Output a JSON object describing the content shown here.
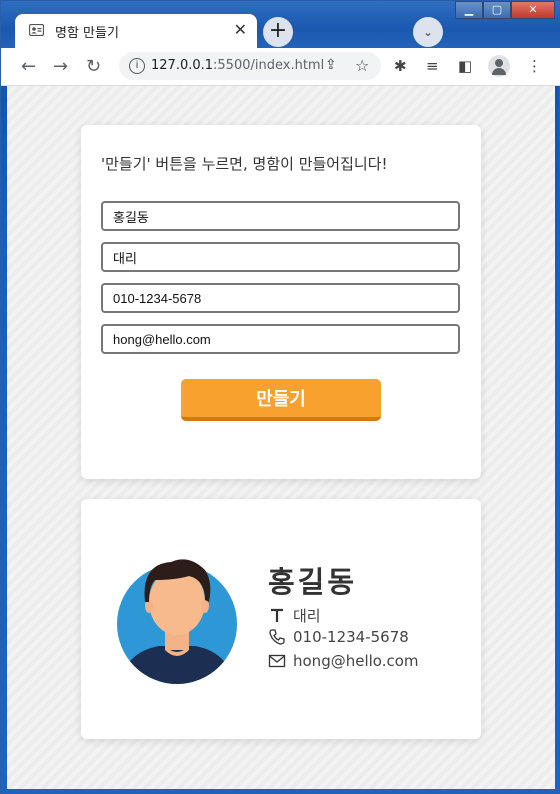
{
  "browser": {
    "tab_title": "명함 만들기",
    "url_host": "127.0.0.1",
    "url_rest": ":5500/index.html"
  },
  "form": {
    "title": "'만들기' 버튼을 누르면, 명함이 만들어집니다!",
    "name_value": "홍길동",
    "position_value": "대리",
    "phone_value": "010-1234-5678",
    "email_value": "hong@hello.com",
    "button_label": "만들기"
  },
  "card": {
    "name": "홍길동",
    "position": "대리",
    "phone": "010-1234-5678",
    "email": "hong@hello.com",
    "icons": [
      "title-icon",
      "phone-icon",
      "mail-icon"
    ]
  },
  "colors": {
    "accent": "#f9a12e",
    "avatar_bg": "#2e97d5"
  }
}
